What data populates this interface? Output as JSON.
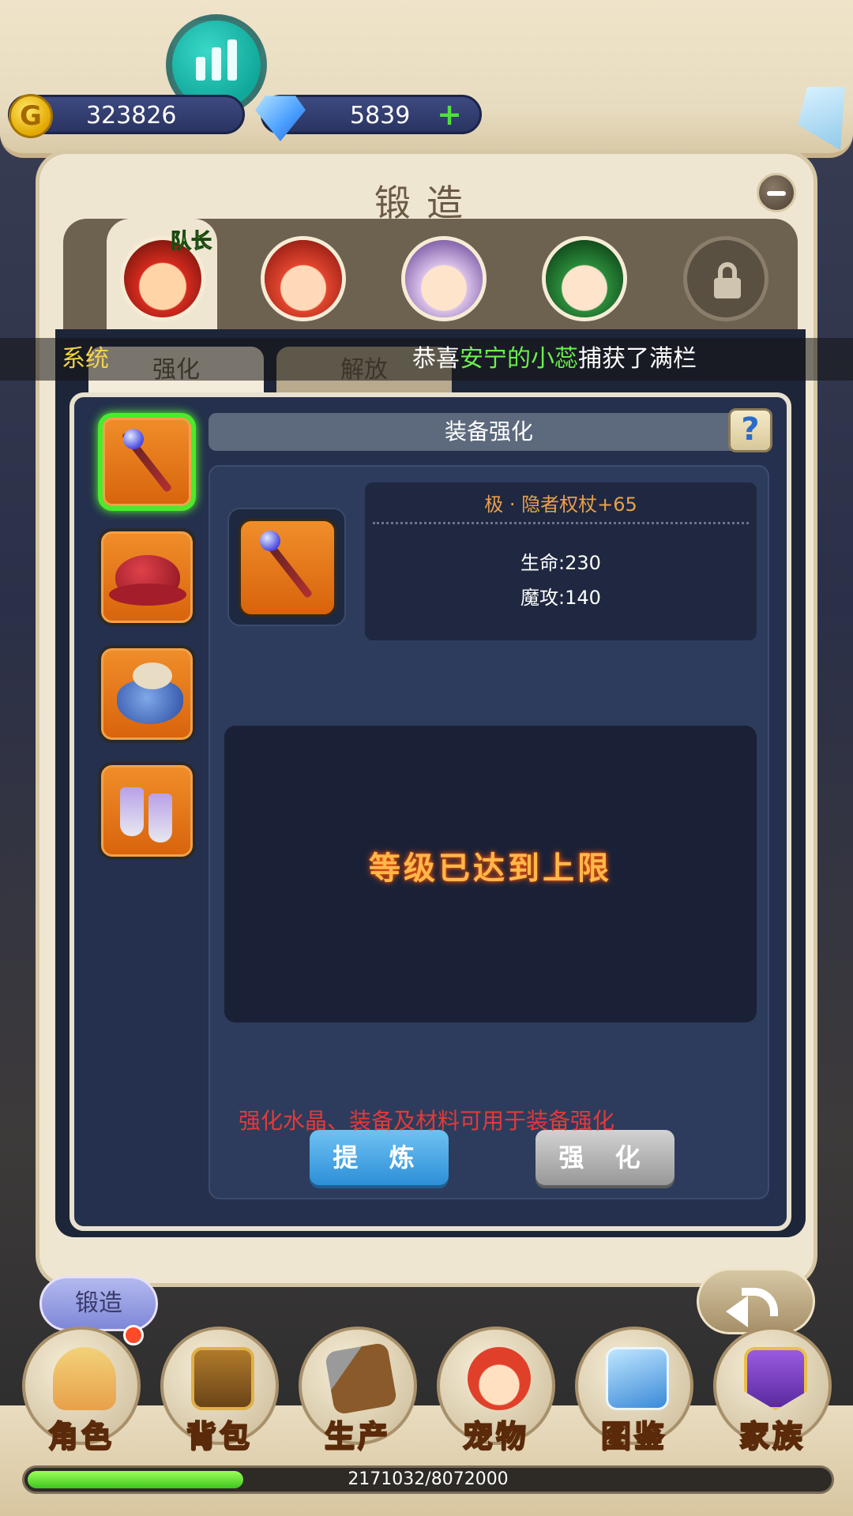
{
  "header": {
    "gold": "323826",
    "gems": "5839",
    "plus": "+"
  },
  "panel": {
    "title": "锻造",
    "leader_tag": "队长",
    "tabs": [
      {
        "label": "强化",
        "active": true
      },
      {
        "label": "解放",
        "active": false
      }
    ]
  },
  "broadcast": {
    "channel": "系统",
    "prefix": "恭喜",
    "player": "安宁的小蕊",
    "suffix": "捕获了满栏"
  },
  "forge": {
    "section_title": "装备强化",
    "help": "?",
    "item_name": "极 · 隐者权杖+65",
    "stats": [
      "生命:230",
      "魔攻:140"
    ],
    "max_level_message": "等级已达到上限",
    "refine_label": "提 炼",
    "enhance_label": "强 化",
    "hint": "强化水晶、装备及材料可用于装备强化"
  },
  "bottom": {
    "forge_pill": "锻造",
    "nav": [
      "角色",
      "背包",
      "生产",
      "宠物",
      "图鉴",
      "家族"
    ],
    "xp_text": "2171032/8072000",
    "xp_progress": 0.269
  },
  "colors": {
    "accent_green": "#6cf04c",
    "warning_orange": "#ffb84a",
    "hint_red": "#e33a3a"
  }
}
